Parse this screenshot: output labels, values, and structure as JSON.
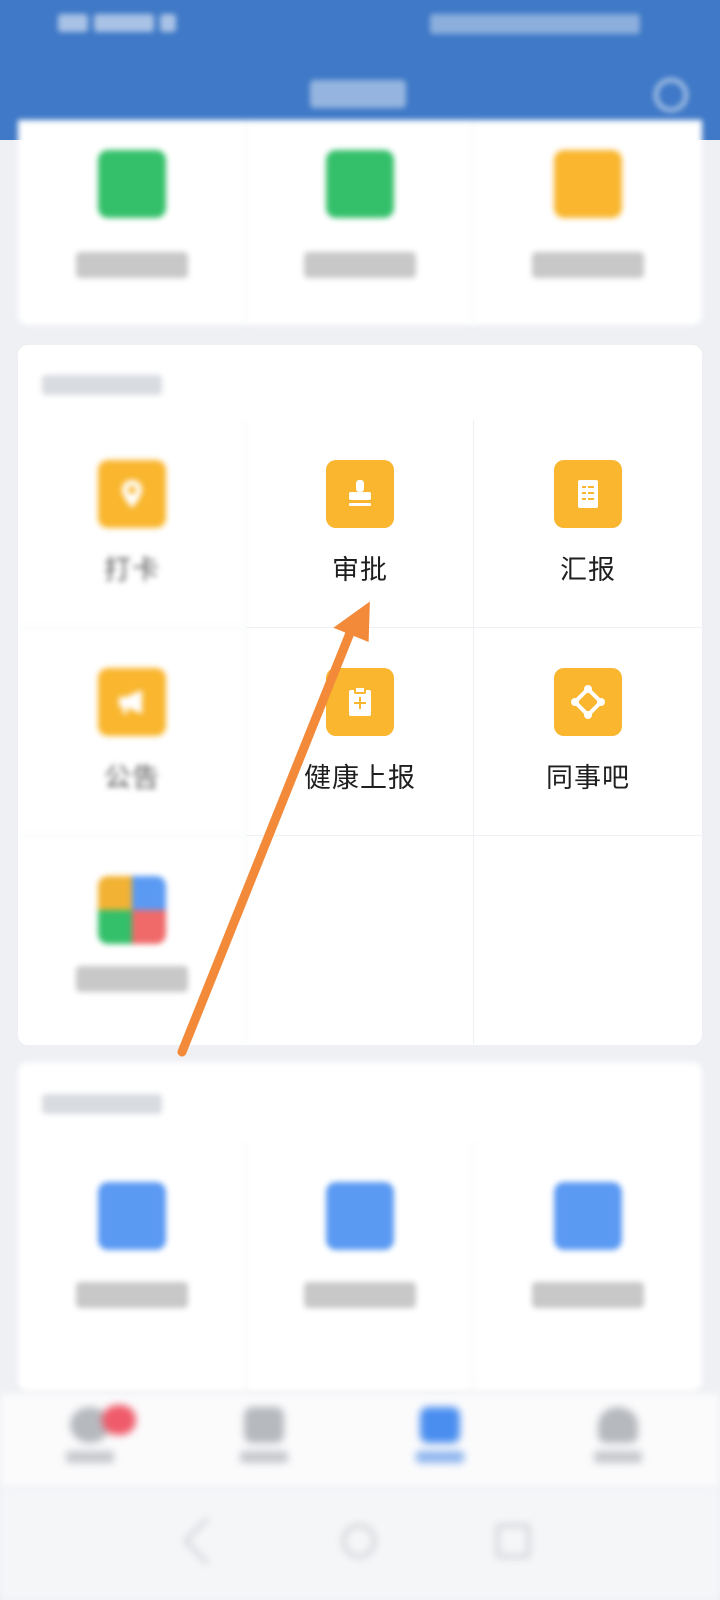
{
  "header": {
    "title": "",
    "status_bar": ""
  },
  "workbench": {
    "apps": [
      {
        "label": "打卡",
        "icon": "location-pin-icon",
        "color": "#f9b62e"
      },
      {
        "label": "审批",
        "icon": "stamp-icon",
        "color": "#f9b62e"
      },
      {
        "label": "汇报",
        "icon": "report-document-icon",
        "color": "#f9b62e"
      },
      {
        "label": "公告",
        "icon": "megaphone-icon",
        "color": "#f9b62e"
      },
      {
        "label": "健康上报",
        "icon": "health-clipboard-icon",
        "color": "#f9b62e"
      },
      {
        "label": "同事吧",
        "icon": "network-nodes-icon",
        "color": "#f9b62e"
      },
      {
        "label": "",
        "icon": "apps-grid-icon"
      }
    ]
  },
  "colors": {
    "header_bg": "#3f79c7",
    "accent_orange": "#f9b62e",
    "arrow": "#f28a3a"
  }
}
